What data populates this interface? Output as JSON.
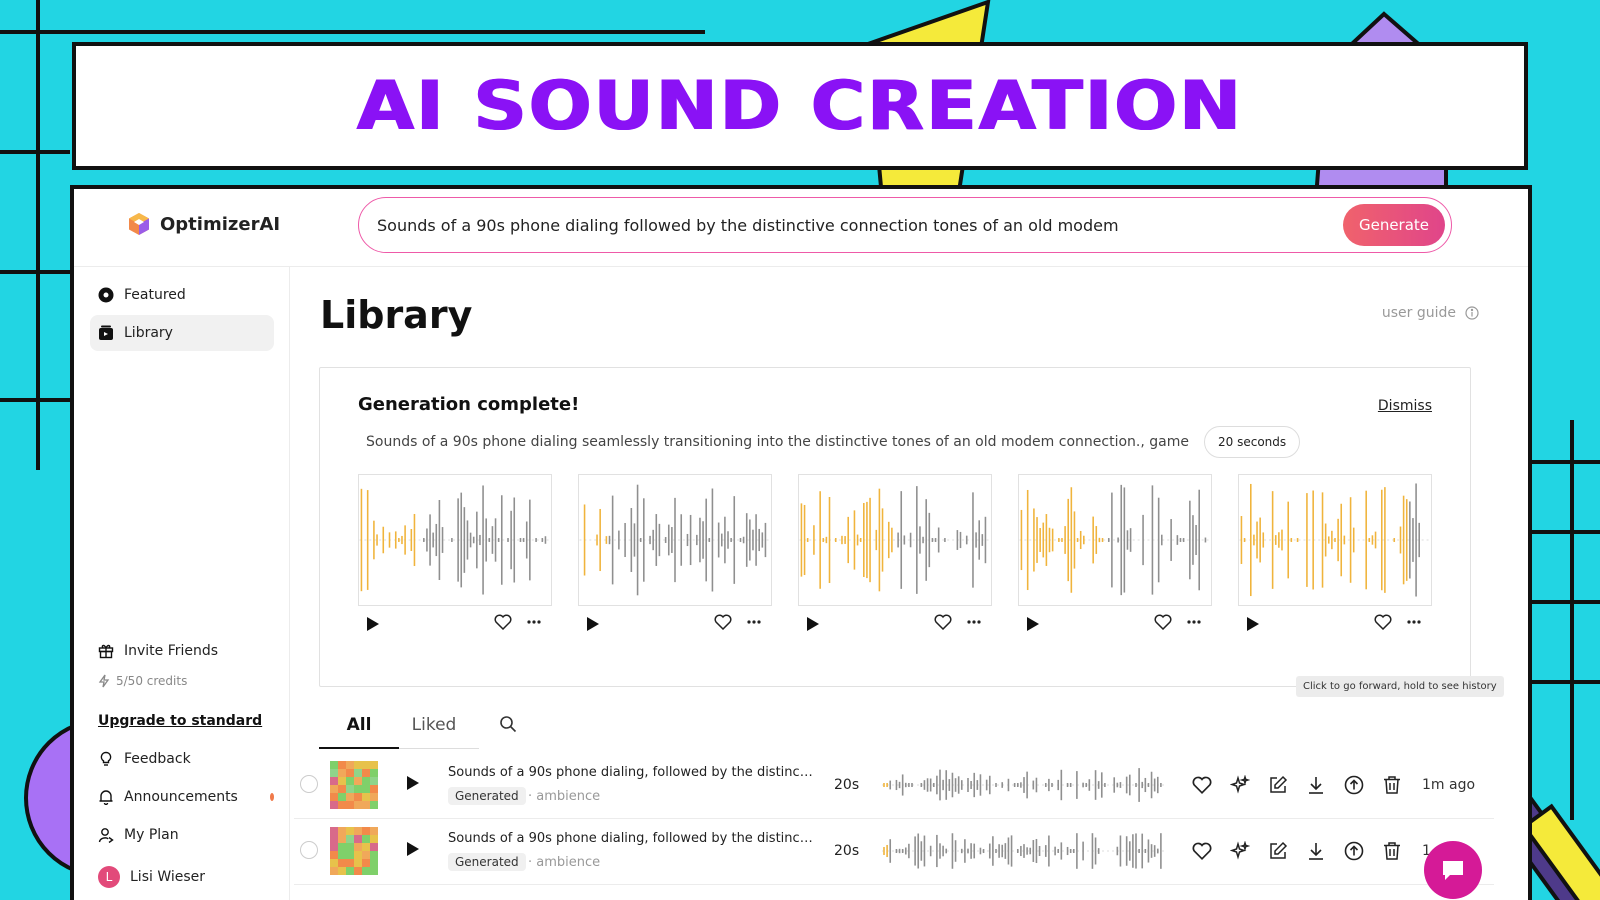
{
  "banner": {
    "title": "AI SOUND CREATION"
  },
  "app": {
    "name": "OptimizerAI",
    "prompt": "Sounds of a 90s phone dialing followed by the distinctive connection tones of an old modem",
    "generate_label": "Generate"
  },
  "sidebar": {
    "items": [
      {
        "label": "Featured",
        "icon": "featured-icon"
      },
      {
        "label": "Library",
        "icon": "library-icon",
        "active": true
      }
    ],
    "invite_label": "Invite Friends",
    "credits": "5/50 credits",
    "upgrade_label": "Upgrade to standard",
    "feedback_label": "Feedback",
    "announcements_label": "Announcements",
    "plan_label": "My Plan",
    "user": {
      "initial": "L",
      "name": "Lisi Wieser"
    }
  },
  "main": {
    "title": "Library",
    "user_guide": "user guide",
    "card": {
      "title": "Generation complete!",
      "dismiss": "Dismiss",
      "description": "Sounds of a 90s phone dialing seamlessly transitioning into the distinctive tones of an old modem connection., game",
      "duration": "20 seconds"
    },
    "tooltip": "Click to go forward, hold to see history",
    "tabs": [
      "All",
      "Liked"
    ],
    "rows": [
      {
        "title": "Sounds of a 90s phone dialing, followed by the distinctive t...",
        "tag": "Generated",
        "category": "· ambience",
        "duration": "20s",
        "time": "1m ago"
      },
      {
        "title": "Sounds of a 90s phone dialing, followed by the distinctive t...",
        "tag": "Generated",
        "category": "· ambience",
        "duration": "20s",
        "time": "1"
      }
    ]
  },
  "colors": {
    "accent_purple": "#8a12f5",
    "background": "#22d5e3",
    "wave_orange": "#f0b43c",
    "wave_gray": "#8f8f8f",
    "generate_gradient_start": "#f0626c",
    "generate_gradient_end": "#e0458a"
  }
}
